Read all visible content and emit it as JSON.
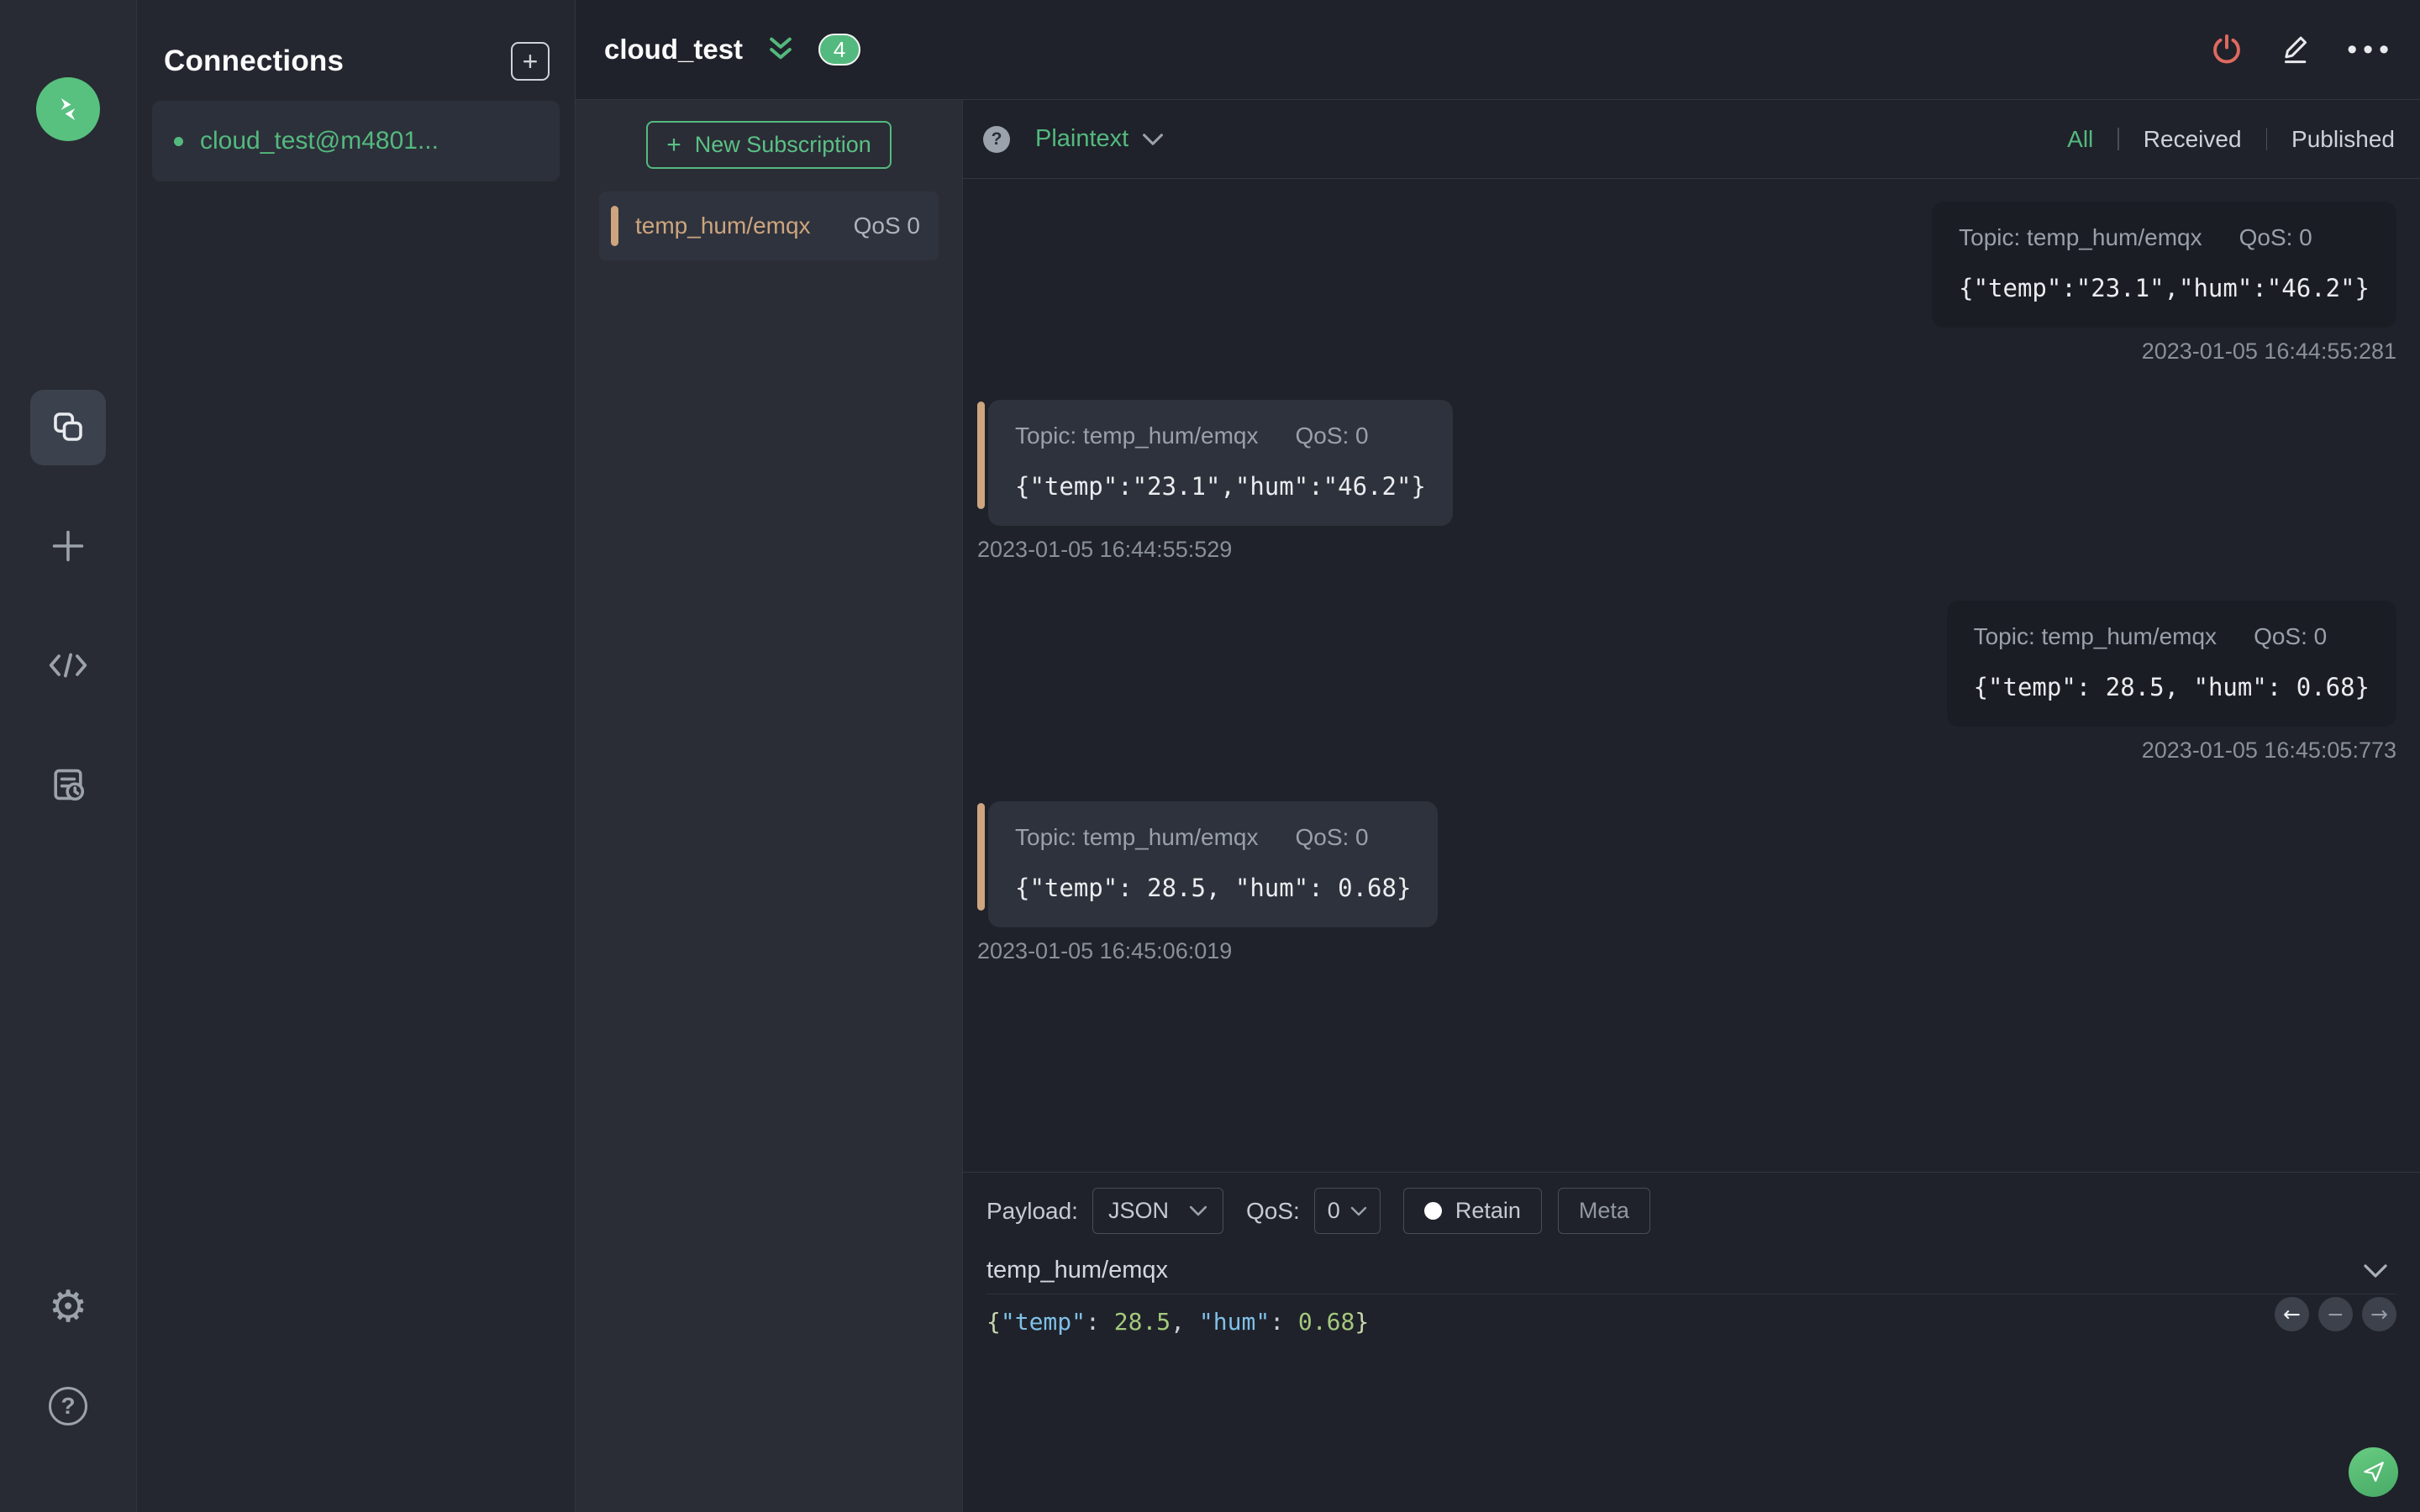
{
  "colors": {
    "accent_green": "#54b97e",
    "logo_green": "#58c17f",
    "danger_red": "#e06a5e",
    "tan_accent": "#cda57e",
    "syntax_key_blue": "#7fc0e8",
    "syntax_num_green": "#a4c97c"
  },
  "connections_panel": {
    "title": "Connections",
    "items": [
      {
        "name": "cloud_test@m4801...",
        "connected": true
      }
    ]
  },
  "header": {
    "connection_name": "cloud_test",
    "unread_badge": "4"
  },
  "subscriptions": {
    "new_button_plus": "+",
    "new_button_label": "New Subscription",
    "items": [
      {
        "topic": "temp_hum/emqx",
        "qos": "QoS 0"
      }
    ]
  },
  "toolbar": {
    "help_glyph": "?",
    "format_selected": "Plaintext",
    "filters": {
      "all": "All",
      "received": "Received",
      "published": "Published"
    }
  },
  "messages": [
    {
      "direction": "published",
      "topic": "Topic: temp_hum/emqx",
      "qos": "QoS: 0",
      "payload": "{\"temp\":\"23.1\",\"hum\":\"46.2\"}",
      "timestamp": "2023-01-05 16:44:55:281"
    },
    {
      "direction": "received",
      "topic": "Topic: temp_hum/emqx",
      "qos": "QoS: 0",
      "payload": "{\"temp\":\"23.1\",\"hum\":\"46.2\"}",
      "timestamp": "2023-01-05 16:44:55:529"
    },
    {
      "direction": "published",
      "topic": "Topic: temp_hum/emqx",
      "qos": "QoS: 0",
      "payload": "{\"temp\": 28.5, \"hum\": 0.68}",
      "timestamp": "2023-01-05 16:45:05:773"
    },
    {
      "direction": "received",
      "topic": "Topic: temp_hum/emqx",
      "qos": "QoS: 0",
      "payload": "{\"temp\": 28.5, \"hum\": 0.68}",
      "timestamp": "2023-01-05 16:45:06:019"
    }
  ],
  "publish": {
    "payload_label": "Payload:",
    "format_value": "JSON",
    "qos_label": "QoS:",
    "qos_value": "0",
    "retain_label": "Retain",
    "meta_label": "Meta",
    "topic_value": "temp_hum/emqx",
    "history_prev": "←",
    "history_clear": "−",
    "history_next": "→",
    "payload_tokens": [
      {
        "text": "{",
        "type": "brace"
      },
      {
        "text": "\"temp\"",
        "type": "key"
      },
      {
        "text": ": ",
        "type": "punct"
      },
      {
        "text": "28.5",
        "type": "num"
      },
      {
        "text": ", ",
        "type": "punct"
      },
      {
        "text": "\"hum\"",
        "type": "key"
      },
      {
        "text": ": ",
        "type": "punct"
      },
      {
        "text": "0.68",
        "type": "num"
      },
      {
        "text": "}",
        "type": "brace"
      }
    ]
  }
}
